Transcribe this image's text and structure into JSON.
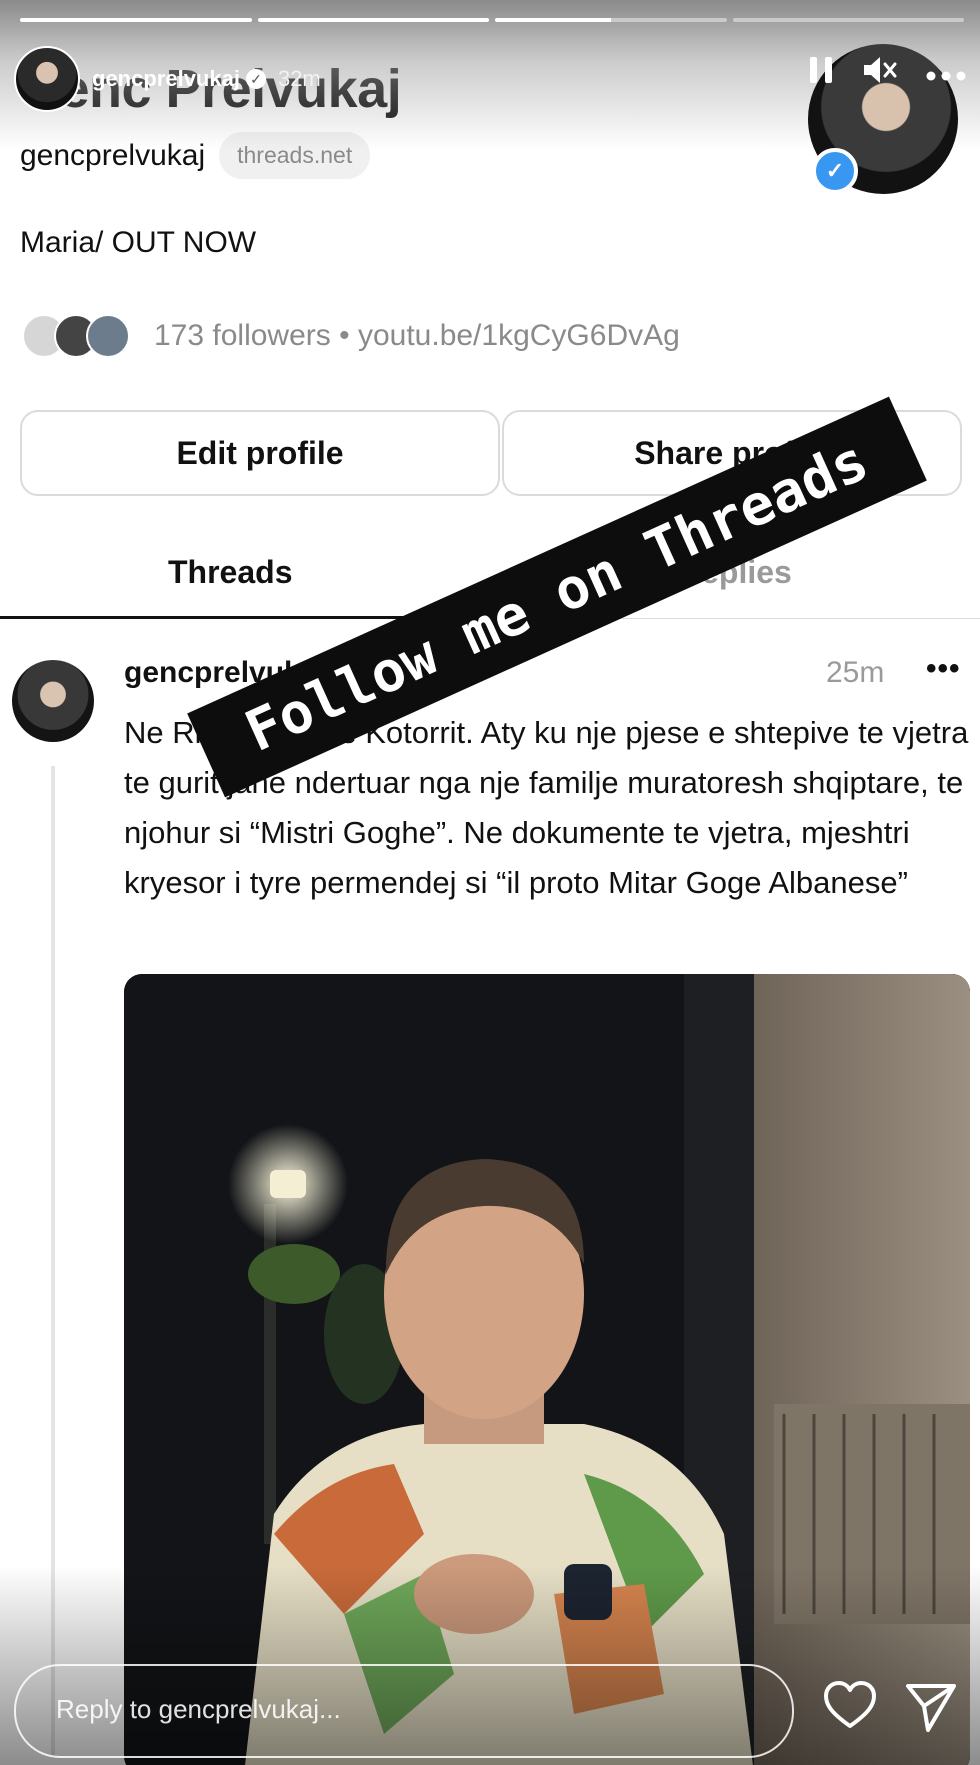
{
  "story": {
    "progress": [
      1.0,
      1.0,
      0.5,
      0.0
    ],
    "user": "gencprelvukaj",
    "time": "32m",
    "controls": {
      "pause_icon": "pause-icon",
      "mute_icon": "muted-speaker-icon",
      "more_icon": "more-options-icon"
    },
    "reply_placeholder": "Reply to gencprelvukaj...",
    "like_icon": "heart-icon",
    "share_icon": "send-icon"
  },
  "profile": {
    "name": "Genc Prelvukaj",
    "handle": "gencprelvukaj",
    "domain": "threads.net",
    "bio": "Maria/ OUT NOW",
    "followers": "173 followers",
    "separator": "•",
    "link": "youtu.be/1kgCyG6DvAg",
    "edit_button": "Edit profile",
    "share_button": "Share profile"
  },
  "tabs": [
    {
      "label": "Threads",
      "active": true
    },
    {
      "label": "Replies",
      "active": false
    }
  ],
  "post": {
    "user": "gencprelvukaj",
    "time": "25m",
    "more": "•••",
    "text": "Ne Rishan prane Kotorrit. Aty ku nje pjese e shtepive te vjetra te gurit jane ndertuar nga nje familje muratoresh shqiptare, te njohur si “Mistri Goghe”. Ne dokumente te vjetra, mjeshtri kryesor i tyre permendej si “il proto Mitar Goge Albanese”"
  },
  "sticker": {
    "text": "Follow me on Threads"
  },
  "colors": {
    "verified": "#3897f0",
    "muted_text": "#8a8a8a",
    "sticker_bg": "#0d0d0d"
  }
}
